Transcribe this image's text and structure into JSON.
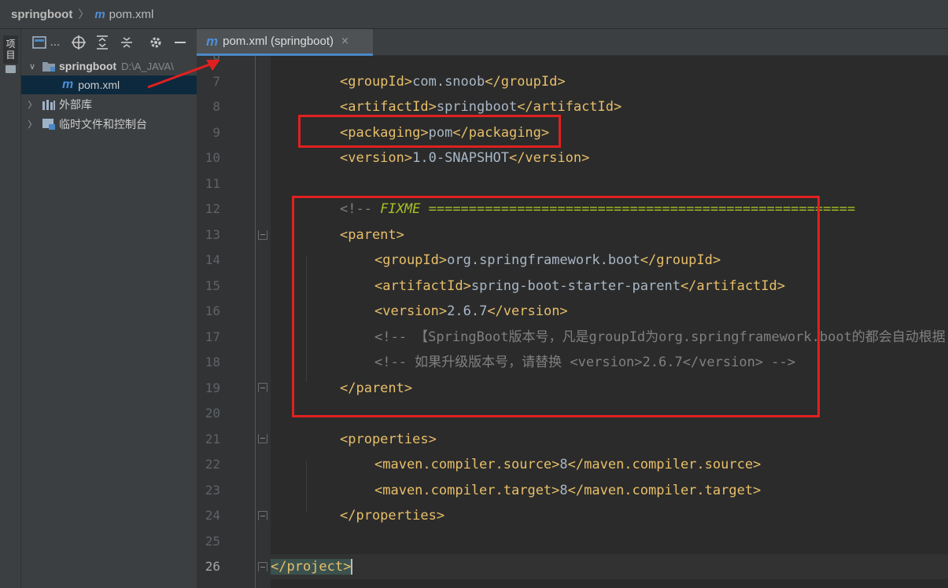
{
  "navbar": {
    "project": "springboot",
    "separator": "〉",
    "file_icon": "m",
    "file": "pom.xml"
  },
  "toolstrip": {
    "project_label": "项目"
  },
  "project_panel": {
    "toolbar_icons": [
      "panel-layout-icon",
      "locate-icon",
      "expand-all-icon",
      "collapse-all-icon",
      "gear-icon",
      "minimize-icon"
    ],
    "toolbar_dots": "...",
    "tree": [
      {
        "arrow": "∨",
        "label": "springboot",
        "path": "D:\\A_JAVA\\",
        "bold": true
      },
      {
        "arrow": "",
        "icon": "m",
        "label": "pom.xml",
        "selected": true
      },
      {
        "arrow": "〉",
        "label": "外部库"
      },
      {
        "arrow": "〉",
        "label": "临时文件和控制台"
      }
    ]
  },
  "editor_tab": {
    "icon": "m",
    "label": "pom.xml (springboot)",
    "close": "×"
  },
  "editor": {
    "lines": [
      {
        "n": "8",
        "text": ""
      },
      {
        "n": "7",
        "text": "<groupId>com.snoob</groupId>"
      },
      {
        "n": "8",
        "text": "<artifactId>springboot</artifactId>"
      },
      {
        "n": "9",
        "text": "<packaging>pom</packaging>"
      },
      {
        "n": "10",
        "text": "<version>1.0-SNAPSHOT</version>"
      },
      {
        "n": "11",
        "text": ""
      },
      {
        "n": "12",
        "text": "<!-- FIXME ====================================================="
      },
      {
        "n": "13",
        "text": "<parent>"
      },
      {
        "n": "14",
        "text": "<groupId>org.springframework.boot</groupId>"
      },
      {
        "n": "15",
        "text": "<artifactId>spring-boot-starter-parent</artifactId>"
      },
      {
        "n": "16",
        "text": "<version>2.6.7</version>"
      },
      {
        "n": "17",
        "text": "<!-- 【SpringBoot版本号，凡是groupId为org.springframework.boot的都会自动根据"
      },
      {
        "n": "18",
        "text": "<!-- 如果升级版本号，请替换 <version>2.6.7</version> -->"
      },
      {
        "n": "19",
        "text": "</parent>"
      },
      {
        "n": "20",
        "text": ""
      },
      {
        "n": "21",
        "text": "<properties>"
      },
      {
        "n": "22",
        "text": "<maven.compiler.source>8</maven.compiler.source>"
      },
      {
        "n": "23",
        "text": "<maven.compiler.target>8</maven.compiler.target>"
      },
      {
        "n": "24",
        "text": "</properties>"
      },
      {
        "n": "25",
        "text": ""
      },
      {
        "n": "26",
        "text": "</project>"
      }
    ]
  },
  "colors": {
    "annotation_red": "#e02020",
    "tag_yellow": "#e8bf6a",
    "text": "#a9b7c6",
    "comment": "#808080",
    "fixme": "#a8c023",
    "maven_blue": "#4d8fd6"
  }
}
